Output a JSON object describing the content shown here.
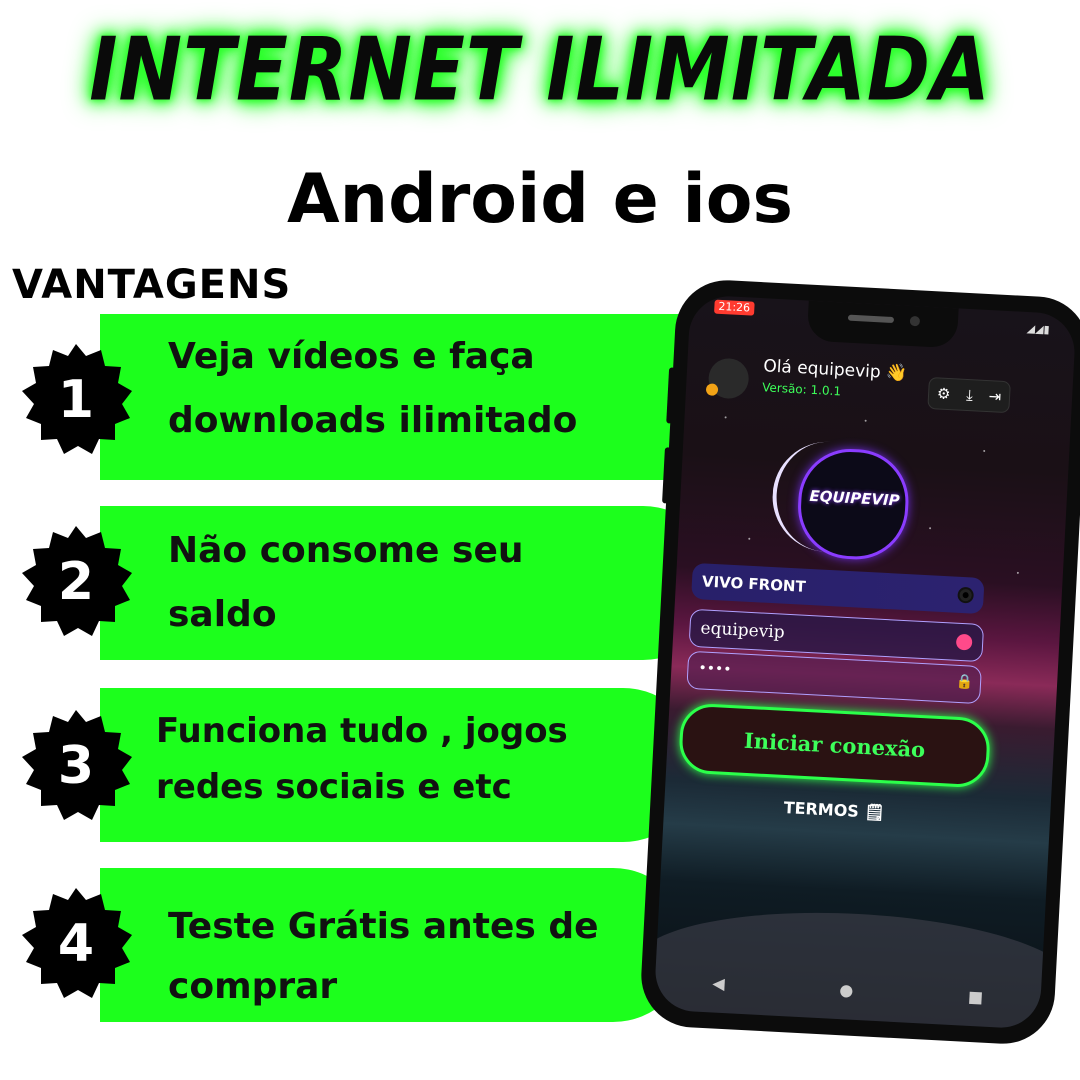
{
  "header": {
    "title": "INTERNET ILIMITADA",
    "subtitle": "Android e ios",
    "section_label": "VANTAGENS"
  },
  "advantages": [
    {
      "number": "1",
      "line1": "Veja vídeos e faça",
      "line2": "downloads ilimitado"
    },
    {
      "number": "2",
      "line1": "Não consome seu",
      "line2": "saldo"
    },
    {
      "number": "3",
      "line1": "Funciona tudo , jogos",
      "line2": "redes sociais e etc"
    },
    {
      "number": "4",
      "line1": "Teste Grátis antes de",
      "line2": "comprar"
    }
  ],
  "phone": {
    "status_time": "21:26",
    "status_icons": "◢◢▮",
    "greeting": "Olá equipevip 👋",
    "version": "Versão: 1.0.1",
    "toolbar_icons": [
      "gear-icon",
      "download-icon",
      "logout-icon"
    ],
    "logo_text": "EQUIPEVIP",
    "server": "VIVO FRONT",
    "username": "equipevip",
    "password_mask": "••••",
    "connect_label": "Iniciar conexão",
    "terms_label": "TERMOS 🗒",
    "nav_icons": [
      "back-icon",
      "home-icon",
      "recents-icon"
    ]
  },
  "colors": {
    "accent_green": "#1cff1c",
    "badge_black": "#000000",
    "connect_green": "#3dff5a",
    "logo_purple": "#8a3cff"
  }
}
